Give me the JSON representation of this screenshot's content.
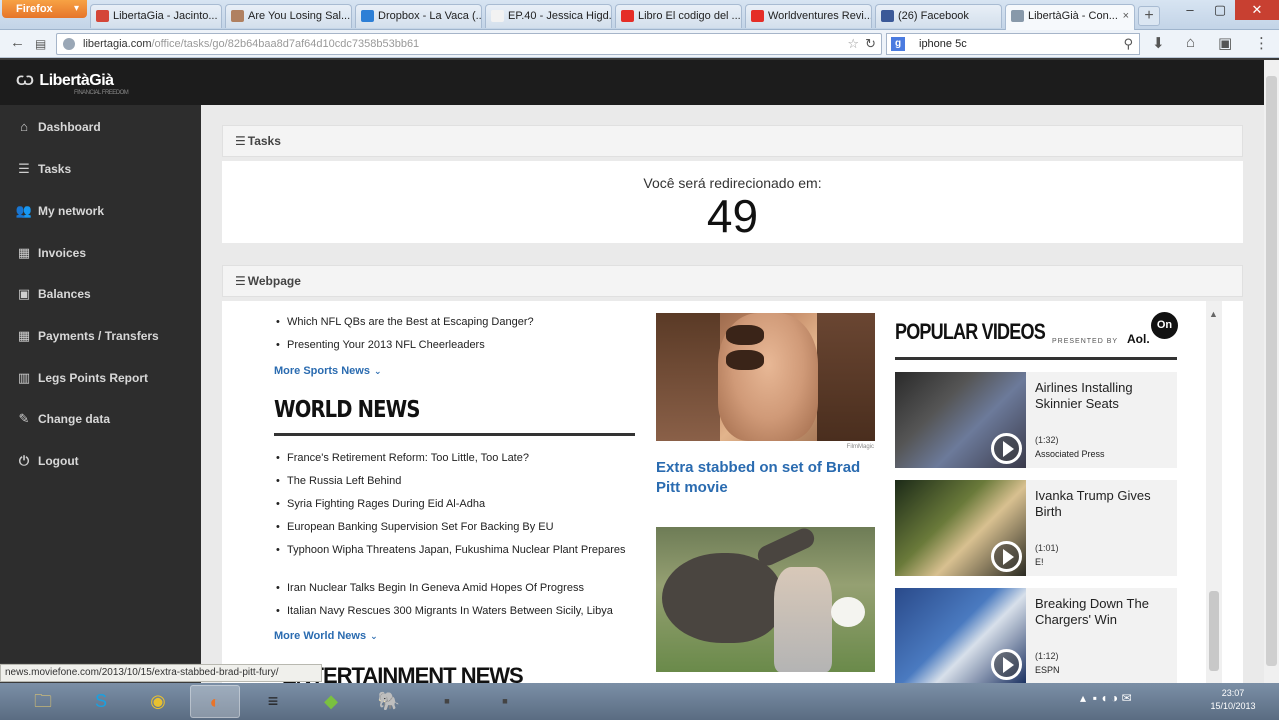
{
  "browser": {
    "menu_button": "Firefox",
    "tabs": [
      {
        "label": "LibertaGia - Jacinto...",
        "icon": "gmail-icon",
        "color": "#d44638"
      },
      {
        "label": "Are You Losing Sal...",
        "icon": "person-icon",
        "color": "#b08060"
      },
      {
        "label": "Dropbox - La Vaca (...",
        "icon": "dropbox-icon",
        "color": "#2d7fd6"
      },
      {
        "label": "EP.40 - Jessica Higd...",
        "icon": "podcast-icon",
        "color": "#f2f2f2"
      },
      {
        "label": "Libro El codigo del ...",
        "icon": "youtube-icon",
        "color": "#e52d27"
      },
      {
        "label": "Worldventures Revi...",
        "icon": "youtube-icon",
        "color": "#e52d27"
      },
      {
        "label": "(26) Facebook",
        "icon": "facebook-icon",
        "color": "#3b5998"
      },
      {
        "label": "LibertàGià - Con...",
        "icon": "libertagia-icon",
        "color": "#8899aa"
      }
    ],
    "active_tab_index": 7,
    "new_tab": "+",
    "window_controls": {
      "minimize": "–",
      "maximize": "▢",
      "close": "✕"
    },
    "url_domain": "libertagia.com",
    "url_path": "/office/tasks/go/82b64baa8d7af64d10cdc7358b53bb61",
    "search_engine": "g",
    "search_value": "iphone 5c"
  },
  "app": {
    "logo": "LibertàGià",
    "logo_tagline": "FINANCIAL FREEDOM",
    "sidebar": [
      {
        "label": "Dashboard",
        "icon": "home-icon",
        "glyph": "⌂"
      },
      {
        "label": "Tasks",
        "icon": "list-icon",
        "glyph": "☰"
      },
      {
        "label": "My network",
        "icon": "users-icon",
        "glyph": "👥"
      },
      {
        "label": "Invoices",
        "icon": "table-icon",
        "glyph": "▦"
      },
      {
        "label": "Balances",
        "icon": "money-icon",
        "glyph": "▣"
      },
      {
        "label": "Payments / Transfers",
        "icon": "table-icon",
        "glyph": "▦"
      },
      {
        "label": "Legs Points Report",
        "icon": "chart-icon",
        "glyph": "▥"
      },
      {
        "label": "Change data",
        "icon": "edit-icon",
        "glyph": "✎"
      },
      {
        "label": "Logout",
        "icon": "power-icon",
        "glyph": "⏻"
      }
    ],
    "tasks_panel_title": "Tasks",
    "redirect_label": "Você será redirecionado em:",
    "countdown": "49",
    "webpage_panel_title": "Webpage"
  },
  "webpage": {
    "sports_items": [
      "Which NFL QBs are the Best at Escaping Danger?",
      "Presenting Your 2013 NFL Cheerleaders"
    ],
    "more_sports": "More Sports News",
    "world_title": "WORLD NEWS",
    "world_items": [
      "France's Retirement Reform: Too Little, Too Late?",
      "The Russia Left Behind",
      "Syria Fighting Rages During Eid Al-Adha",
      "European Banking Supervision Set For Backing By EU",
      "Typhoon Wipha Threatens Japan, Fukushima Nuclear Plant Prepares",
      "Iran Nuclear Talks Begin In Geneva Amid Hopes Of Progress",
      "Italian Navy Rescues 300 Migrants In Waters Between Sicily, Libya"
    ],
    "more_world": "More World News",
    "ent_title": "ENTERTAINMENT NEWS",
    "photo_credit": "FilmMagic",
    "headline": "Extra stabbed on set of Brad Pitt movie",
    "popular_videos_title": "POPULAR VIDEOS",
    "presented_by": "PRESENTED BY",
    "sponsor": "Aol.",
    "sponsor_badge": "On",
    "videos": [
      {
        "title": "Airlines Installing Skinnier Seats",
        "duration": "(1:32)",
        "source": "Associated Press"
      },
      {
        "title": "Ivanka Trump Gives Birth",
        "duration": "(1:01)",
        "source": "E!"
      },
      {
        "title": "Breaking Down The Chargers' Win",
        "duration": "(1:12)",
        "source": "ESPN"
      }
    ]
  },
  "status_url": "news.moviefone.com/2013/10/15/extra-stabbed-brad-pitt-fury/",
  "taskbar": {
    "apps": [
      {
        "name": "explorer",
        "glyph": "🗀"
      },
      {
        "name": "skype",
        "glyph": "S"
      },
      {
        "name": "chrome",
        "glyph": "◉"
      },
      {
        "name": "firefox",
        "glyph": "◐"
      },
      {
        "name": "layers",
        "glyph": "≡"
      },
      {
        "name": "app-green",
        "glyph": "◆"
      },
      {
        "name": "evernote",
        "glyph": "🐘"
      },
      {
        "name": "app-box",
        "glyph": "▪"
      },
      {
        "name": "app-box2",
        "glyph": "▪"
      }
    ],
    "active_index": 3,
    "time": "23:07",
    "date": "15/10/2013"
  }
}
